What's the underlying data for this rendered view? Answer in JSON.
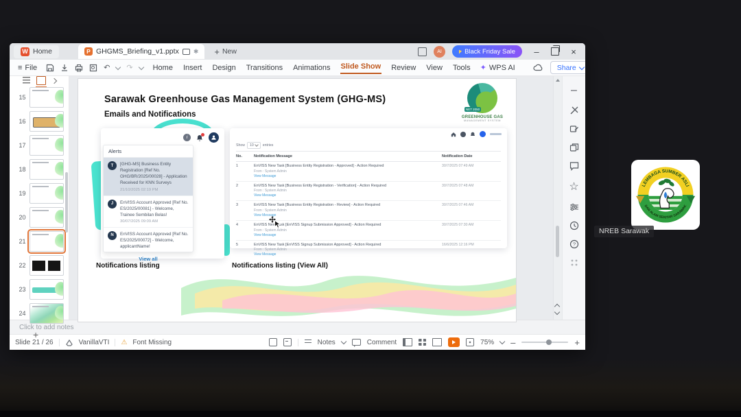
{
  "meeting": {
    "participant_label": "NREB Sarawak",
    "logo_top_text": "LEMBAGA SUMBER ASLI",
    "logo_bottom_text": "DAN ALAM SEKITAR SARAWAK"
  },
  "window": {
    "home_tab": "Home",
    "doc_tab": "GHGMS_Briefing_v1.pptx",
    "new_tab": "New",
    "promo": "Black Friday Sale",
    "file": "File",
    "menus": [
      "Home",
      "Insert",
      "Design",
      "Transitions",
      "Animations",
      "Slide Show",
      "Review",
      "View",
      "Tools"
    ],
    "wps_ai": "WPS AI",
    "share": "Share"
  },
  "thumbnails": {
    "items": [
      {
        "num": "15"
      },
      {
        "num": "16"
      },
      {
        "num": "17"
      },
      {
        "num": "18"
      },
      {
        "num": "19"
      },
      {
        "num": "20"
      },
      {
        "num": "21"
      },
      {
        "num": "22"
      },
      {
        "num": "23"
      },
      {
        "num": "24"
      }
    ]
  },
  "slide": {
    "title": "Sarawak Greenhouse Gas Management System (GHG-MS)",
    "subtitle": "Emails and Notifications",
    "logo_badge": "NET 2050",
    "logo_line1": "GREENHOUSE GAS",
    "logo_line2": "MANAGEMENT SYSTEM",
    "caption_left": "Notifications listing",
    "caption_right": "Notifications listing (View All)",
    "alerts": {
      "header": "Alerts",
      "view_all": "View all",
      "items": [
        {
          "initial": "T",
          "text": "[GHG-MS] Business Entity Registration [Ref No. GHG/BR/2025/00028] - Application Received for KNN Surveys",
          "date": "21/10/2025 02:19 PM"
        },
        {
          "initial": "J",
          "text": "EnVISS Account Approved [Ref No. ES/2025/00081] - Welcome, Trainee Sembilan Belas!",
          "date": "30/07/2025 09:09 AM"
        },
        {
          "initial": "N",
          "text": "EnVISS Account Approved [Ref No. ES/2025/00072] - Welcome, applicantName!",
          "date": ""
        }
      ]
    },
    "table": {
      "show_label": "Show",
      "page_size": "10",
      "entries_label": "entries",
      "headers": {
        "no": "No.",
        "message": "Notification Message",
        "date": "Notification Date"
      },
      "rows": [
        {
          "no": "1",
          "message": "EnVISS New Task [Business Entity Registration - Approved] - Action Required",
          "from": "From : System Admin",
          "link": "View Message",
          "date": "30/7/2025 07:49 AM"
        },
        {
          "no": "2",
          "message": "EnVISS New Task [Business Entity Registration - Verification] - Action Required",
          "from": "From : System Admin",
          "link": "View Message",
          "date": "30/7/2025 07:48 AM"
        },
        {
          "no": "3",
          "message": "EnVISS New Task [Business Entity Registration - Review] - Action Required",
          "from": "From : System Admin",
          "link": "View Message",
          "date": "30/7/2025 07:46 AM"
        },
        {
          "no": "4",
          "message": "EnVISS New Task [EnVISS Signup Submission Approved] - Action Required",
          "from": "From : System Admin",
          "link": "View Message",
          "date": "30/7/2025 07:30 AM"
        },
        {
          "no": "5",
          "message": "EnVISS New Task [EnVISS Signup Submission Approved] - Action Required",
          "from": "From : System Admin",
          "link": "View Message",
          "date": "16/6/2025 12:16 PM"
        }
      ]
    }
  },
  "notes_placeholder": "Click to add notes",
  "statusbar": {
    "slide_indicator": "Slide 21 / 26",
    "theme": "VanillaVTI",
    "font_missing": "Font Missing",
    "notes": "Notes",
    "comment": "Comment",
    "zoom": "75%"
  },
  "icons": {
    "plus": "+",
    "close": "×",
    "minimize": "–",
    "more": "⋯",
    "sparkle": "✦",
    "warning": "⚠",
    "star": "☆",
    "undo": "↶",
    "redo": "↷",
    "hamburger": "≡",
    "info": "i",
    "question": "?",
    "asterisk": "✱",
    "minus": "–"
  },
  "colors": {
    "accent_orange": "#c05a20",
    "promo_blue": "#3f7bff",
    "promo_purple": "#8a53f7",
    "share_blue": "#3370ff",
    "teal_deco": "#4ae3cf",
    "play_orange": "#ed6c0c",
    "link_blue": "#3e9bd6",
    "alert_highlight": "#d7dee7"
  }
}
